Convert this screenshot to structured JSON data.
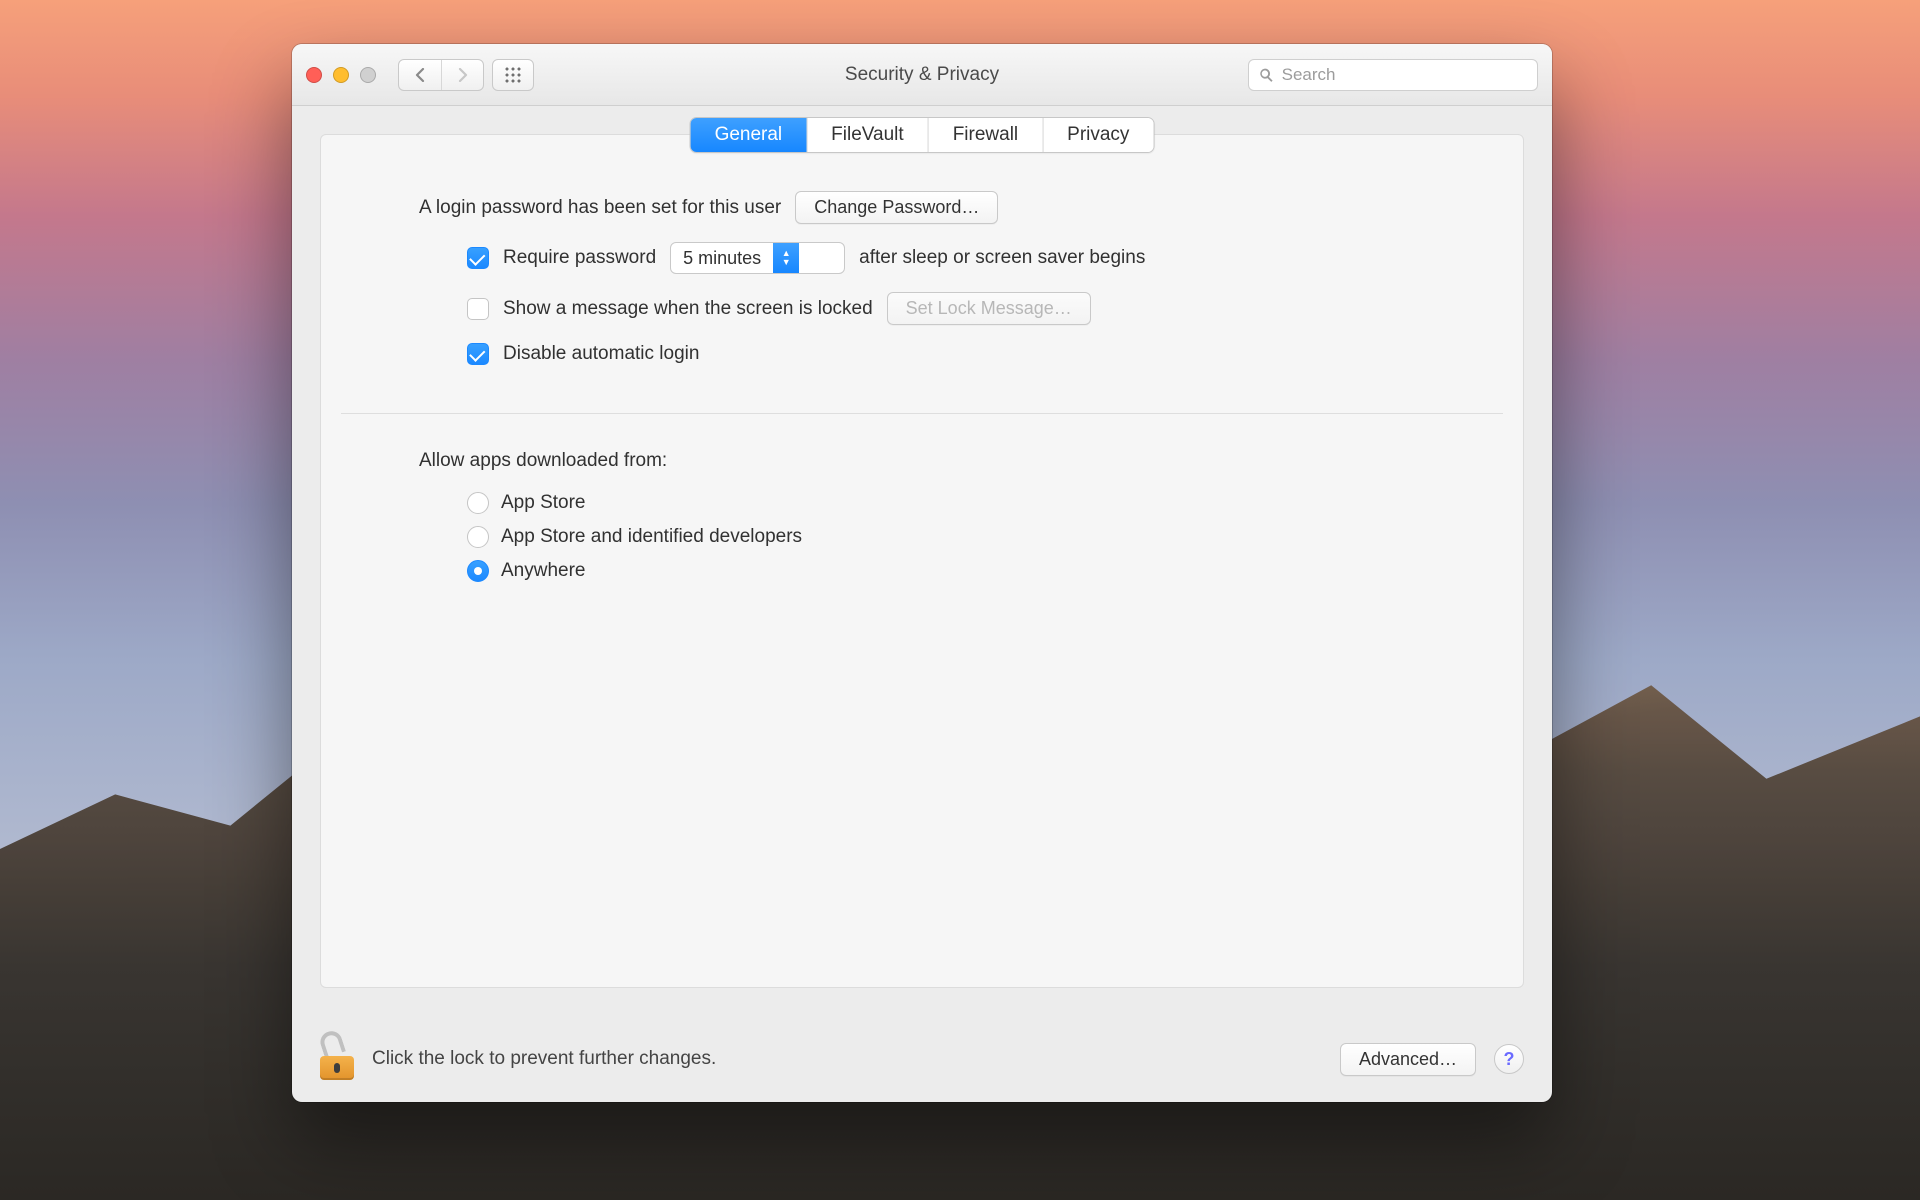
{
  "window": {
    "title": "Security & Privacy",
    "search_placeholder": "Search"
  },
  "tabs": {
    "general": "General",
    "filevault": "FileVault",
    "firewall": "Firewall",
    "privacy": "Privacy",
    "active": "general"
  },
  "login": {
    "password_set_text": "A login password has been set for this user",
    "change_password_btn": "Change Password…",
    "require_password_label": "Require password",
    "require_password_checked": true,
    "delay_selected": "5 minutes",
    "after_sleep_text": "after sleep or screen saver begins",
    "show_message_label": "Show a message when the screen is locked",
    "show_message_checked": false,
    "set_lock_message_btn": "Set Lock Message…",
    "disable_auto_login_label": "Disable automatic login",
    "disable_auto_login_checked": true
  },
  "gatekeeper": {
    "heading": "Allow apps downloaded from:",
    "options": {
      "app_store": "App Store",
      "identified": "App Store and identified developers",
      "anywhere": "Anywhere"
    },
    "selected": "anywhere"
  },
  "footer": {
    "lock_text": "Click the lock to prevent further changes.",
    "advanced_btn": "Advanced…",
    "help": "?"
  }
}
